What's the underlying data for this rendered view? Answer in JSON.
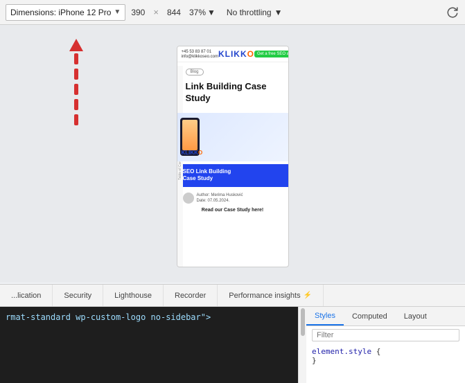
{
  "toolbar": {
    "dimensions_label": "Dimensions: iPhone 12 Pro",
    "dropdown_arrow": "▼",
    "width": "390",
    "separator": "×",
    "height": "844",
    "zoom": "37%",
    "zoom_arrow": "▼",
    "throttle_label": "No throttling",
    "throttle_arrow": "▼"
  },
  "mobile_preview": {
    "phone": "+45 53 83 87 01",
    "email": "info@klikkoseo.com",
    "logo": "KLIKK",
    "logo_o": "O",
    "cta": "Get a free SEO analysis",
    "toc": "Table of Contents",
    "blog_tag": "Blog",
    "title_line1": "Link Building Case",
    "title_line2": "Study",
    "cta_bar_line1": "SEO Link Building",
    "cta_bar_line2": "Case Study",
    "author_line1": "Author: Merima Husković",
    "author_line2": "Date: 07.05.2024.",
    "read_more": "Read our Case Study here!"
  },
  "devtools": {
    "tabs": [
      {
        "label": "...lication",
        "active": false
      },
      {
        "label": "Security",
        "active": false
      },
      {
        "label": "Lighthouse",
        "active": false
      },
      {
        "label": "Recorder",
        "active": false
      },
      {
        "label": "Performance insights",
        "active": false
      },
      {
        "label": "⚡",
        "active": false
      }
    ],
    "right_tabs": [
      {
        "label": "Styles",
        "active": true
      },
      {
        "label": "Computed",
        "active": false
      },
      {
        "label": "Layout",
        "active": false
      }
    ],
    "filter_placeholder": "Filter",
    "code_line": "rmat-standard wp-custom-logo no-sidebar\">",
    "css_selector": "element.style",
    "css_open": "{",
    "css_close": "}"
  }
}
